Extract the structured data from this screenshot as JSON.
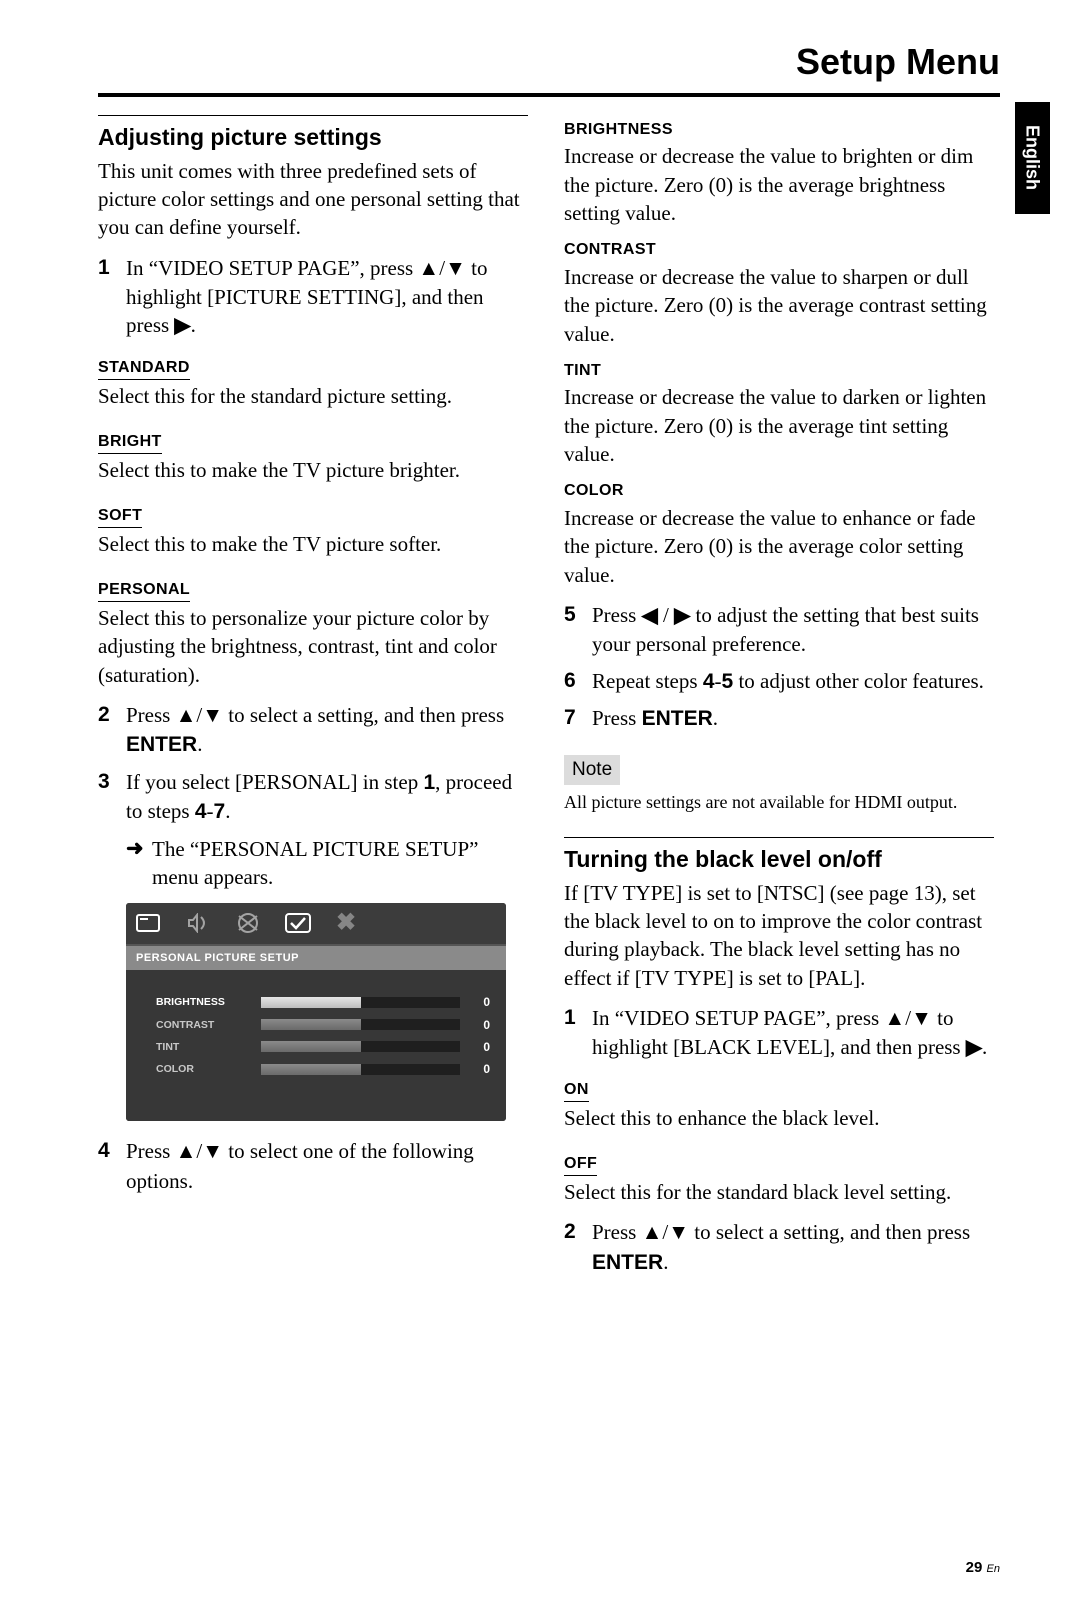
{
  "page": {
    "title": "Setup Menu",
    "sideTab": "English",
    "pageNumber": "29",
    "pageLang": "En"
  },
  "left": {
    "heading": "Adjusting picture settings",
    "intro": "This unit comes with three predefined sets of picture color settings and one personal setting that you can define yourself.",
    "step1_pre": "In “VIDEO SETUP PAGE”, press ",
    "step1_mid": " to highlight [PICTURE SETTING], and then press ",
    "step1_end": ".",
    "standard_label": "STANDARD",
    "standard_text": "Select this for the standard picture setting.",
    "bright_label": "BRIGHT",
    "bright_text": "Select this to make the TV picture brighter.",
    "soft_label": "SOFT",
    "soft_text": "Select this to make the TV picture softer.",
    "personal_label": "PERSONAL",
    "personal_text": "Select this to personalize your picture color by adjusting the brightness, contrast, tint and color (saturation).",
    "step2_pre": "Press ",
    "step2_mid": " to select a setting, and then press ",
    "enter": "ENTER",
    "step2_end": ".",
    "step3_a": "If you select [PERSONAL] in step ",
    "step3_b": "1",
    "step3_c": ", proceed to steps ",
    "step3_d": "4",
    "step3_e": "-",
    "step3_f": "7",
    "step3_g": ".",
    "step3_arrow": "The “PERSONAL PICTURE SETUP” menu appears.",
    "step4_pre": "Press ",
    "step4_end": " to select one of the following options."
  },
  "right": {
    "brightness_label": "BRIGHTNESS",
    "brightness_text": "Increase or decrease the value to brighten or dim the picture. Zero (0) is the average brightness setting value.",
    "contrast_label": "CONTRAST",
    "contrast_text": "Increase or decrease the value to sharpen or dull the picture. Zero (0) is the average contrast setting value.",
    "tint_label": "TINT",
    "tint_text": "Increase or decrease the value to darken or lighten the picture. Zero (0) is the average tint setting value.",
    "color_label": "COLOR",
    "color_text": "Increase or decrease the value to enhance or fade the picture. Zero (0) is the average color setting value.",
    "step5_pre": "Press ",
    "step5_end": " to adjust the setting that best suits your personal preference.",
    "step6_a": "Repeat steps ",
    "step6_b": "4",
    "step6_c": "-",
    "step6_d": "5",
    "step6_e": " to adjust other color features.",
    "step7_pre": "Press ",
    "step7_end": ".",
    "note_label": "Note",
    "note_text": "All picture settings are not available for HDMI output.",
    "heading2": "Turning the black level on/off",
    "black_intro": "If [TV TYPE] is set to [NTSC] (see page 13), set the black level to on to improve the color contrast during playback. The black level setting has no effect if [TV TYPE] is set to [PAL].",
    "bl_step1_pre": "In “VIDEO SETUP PAGE”, press ",
    "bl_step1_mid": " to highlight [BLACK LEVEL], and then press ",
    "bl_step1_end": ".",
    "on_label": "ON",
    "on_text": "Select this to enhance the black level.",
    "off_label": "OFF",
    "off_text": "Select this for the standard black level setting.",
    "bl_step2_pre": "Press ",
    "bl_step2_mid": " to select a setting, and then press ",
    "bl_step2_end": "."
  },
  "osd": {
    "title": "PERSONAL PICTURE SETUP",
    "rows": [
      {
        "label": "BRIGHTNESS",
        "value": "0"
      },
      {
        "label": "CONTRAST",
        "value": "0"
      },
      {
        "label": "TINT",
        "value": "0"
      },
      {
        "label": "COLOR",
        "value": "0"
      }
    ]
  },
  "glyphs": {
    "up": "▲",
    "down": "▼",
    "left": "◀",
    "right": "▶",
    "rarrow": "➜"
  }
}
